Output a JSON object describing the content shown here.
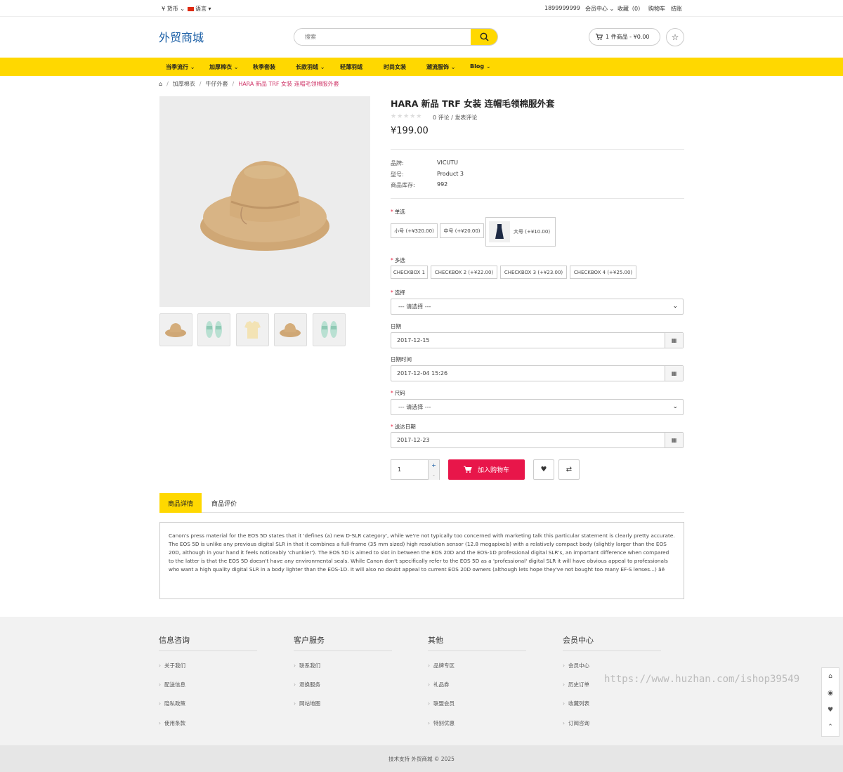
{
  "topbar": {
    "currency": "¥ 货币",
    "language": "语言",
    "phone": "1899999999",
    "member": "会员中心",
    "wishlist": "收藏（0）",
    "cart": "购物车",
    "checkout": "结账"
  },
  "header": {
    "logo": "外贸商城",
    "search_placeholder": "搜索",
    "cart_summary": "1 件商品 - ¥0.00"
  },
  "menu": [
    "当季流行",
    "加厚棉衣",
    "秋季套装",
    "长款羽绒",
    "轻薄羽绒",
    "时尚女装",
    "潮流服饰",
    "Blog"
  ],
  "breadcrumb": [
    "加厚棉衣",
    "牛仔外套",
    "HARA 新品 TRF 女装 连帽毛领棉服外套"
  ],
  "product": {
    "title": "HARA 新品 TRF 女装 连帽毛领棉服外套",
    "reviews": "0 评论 / 发表评论",
    "price": "¥199.00",
    "specs": [
      {
        "label": "品牌:",
        "value": "VICUTU"
      },
      {
        "label": "型号:",
        "value": "Product 3"
      },
      {
        "label": "商品库存:",
        "value": "992"
      }
    ]
  },
  "options": {
    "radio_label": "单选",
    "radio": [
      "小号 (+¥320.00)",
      "中号 (+¥20.00)",
      "大号 (+¥10.00)"
    ],
    "checkbox_label": "多选",
    "checkbox": [
      "CHECKBOX 1",
      "CHECKBOX 2 (+¥22.00)",
      "CHECKBOX 3 (+¥23.00)",
      "CHECKBOX 4 (+¥25.00)"
    ],
    "select_label": "选择",
    "select_value": "--- 请选择 ---",
    "date_label": "日期",
    "date_value": "2017-12-15",
    "datetime_label": "日期时间",
    "datetime_value": "2017-12-04 15:26",
    "size_label": "尺码",
    "size_value": "--- 请选择 ---",
    "delivery_label": "送达日期",
    "delivery_value": "2017-12-23",
    "quantity": "1",
    "add_to_cart": "加入购物车"
  },
  "tabs": [
    "商品详情",
    "商品评价"
  ],
  "description": "Canon's press material for the EOS 5D states that it 'defines (a) new D-SLR category', while we're not typically too concerned with marketing talk this particular statement is clearly pretty accurate. The EOS 5D is unlike any previous digital SLR in that it combines a full-frame (35 mm sized) high resolution sensor (12.8 megapixels) with a relatively compact body (slightly larger than the EOS 20D, although in your hand it feels noticeably 'chunkier'). The EOS 5D is aimed to slot in between the EOS 20D and the EOS-1D professional digital SLR's, an important difference when compared to the latter is that the EOS 5D doesn't have any environmental seals. While Canon don't specifically refer to the EOS 5D as a 'professional' digital SLR it will have obvious appeal to professionals who want a high quality digital SLR in a body lighter than the EOS-1D. It will also no doubt appeal to current EOS 20D owners (although lets hope they've not bought too many EF-S lenses...) äë",
  "footer": {
    "columns": [
      {
        "title": "信息咨询",
        "links": [
          "关于我们",
          "配送信息",
          "隐私政策",
          "使用条款"
        ]
      },
      {
        "title": "客户服务",
        "links": [
          "联系我们",
          "退换服务",
          "网站地图"
        ]
      },
      {
        "title": "其他",
        "links": [
          "品牌专区",
          "礼品券",
          "联盟会员",
          "特别优惠"
        ]
      },
      {
        "title": "会员中心",
        "links": [
          "会员中心",
          "历史订单",
          "收藏列表",
          "订阅咨询"
        ]
      }
    ],
    "copyright": "技术支持 外贸商城 © 2025",
    "watermark": "https://www.huzhan.com/ishop39549"
  },
  "colors": {
    "accent": "#ffd800",
    "cart_button": "#e8164a",
    "logo": "#1b5fa6",
    "breadcrumb_active": "#d0386a"
  }
}
